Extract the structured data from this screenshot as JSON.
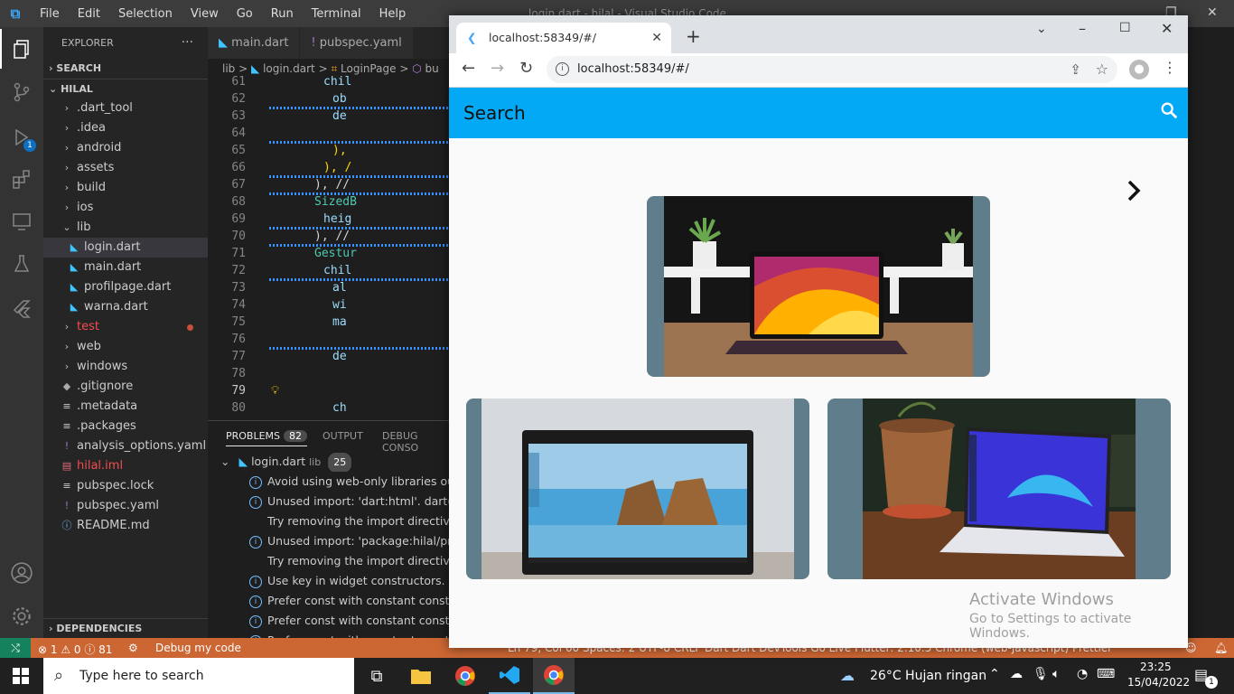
{
  "vscode": {
    "title": "login.dart - hilal - Visual Studio Code",
    "menu": [
      "File",
      "Edit",
      "Selection",
      "View",
      "Go",
      "Run",
      "Terminal",
      "Help"
    ],
    "explorer_label": "EXPLORER",
    "search_section": "SEARCH",
    "project": "HILAL",
    "dependencies": "DEPENDENCIES",
    "run_badge": "1",
    "tree": [
      {
        "label": ".dart_tool",
        "type": "folder"
      },
      {
        "label": ".idea",
        "type": "folder"
      },
      {
        "label": "android",
        "type": "folder"
      },
      {
        "label": "assets",
        "type": "folder"
      },
      {
        "label": "build",
        "type": "folder"
      },
      {
        "label": "ios",
        "type": "folder"
      },
      {
        "label": "lib",
        "type": "folder-open"
      },
      {
        "label": "login.dart",
        "type": "dart",
        "selected": true
      },
      {
        "label": "main.dart",
        "type": "dart"
      },
      {
        "label": "profilpage.dart",
        "type": "dart"
      },
      {
        "label": "warna.dart",
        "type": "dart"
      },
      {
        "label": "test",
        "type": "folder-error"
      },
      {
        "label": "web",
        "type": "folder"
      },
      {
        "label": "windows",
        "type": "folder"
      },
      {
        "label": ".gitignore",
        "type": "git"
      },
      {
        "label": ".metadata",
        "type": "file"
      },
      {
        "label": ".packages",
        "type": "file"
      },
      {
        "label": "analysis_options.yaml",
        "type": "yaml"
      },
      {
        "label": "hilal.iml",
        "type": "iml"
      },
      {
        "label": "pubspec.lock",
        "type": "file"
      },
      {
        "label": "pubspec.yaml",
        "type": "yaml"
      },
      {
        "label": "README.md",
        "type": "info"
      }
    ],
    "tabs": [
      "main.dart",
      "pubspec.yaml"
    ],
    "breadcrumb": [
      "lib",
      ">",
      "login.dart",
      ">",
      "LoginPage",
      ">",
      "bu"
    ],
    "lines": [
      {
        "n": "61",
        "code": "chil",
        "indent": 14
      },
      {
        "n": "62",
        "code": "ob",
        "indent": 15
      },
      {
        "n": "63",
        "code": "de",
        "indent": 15
      },
      {
        "n": "64",
        "code": "",
        "indent": 0
      },
      {
        "n": "65",
        "code": "),",
        "indent": 15
      },
      {
        "n": "66",
        "code": "), /",
        "indent": 14
      },
      {
        "n": "67",
        "code": "), //",
        "indent": 13
      },
      {
        "n": "68",
        "code": "SizedB",
        "indent": 13
      },
      {
        "n": "69",
        "code": "heig",
        "indent": 14
      },
      {
        "n": "70",
        "code": "), //",
        "indent": 13
      },
      {
        "n": "71",
        "code": "Gestur",
        "indent": 13
      },
      {
        "n": "72",
        "code": "chil",
        "indent": 14
      },
      {
        "n": "73",
        "code": "al",
        "indent": 15
      },
      {
        "n": "74",
        "code": "wi",
        "indent": 15
      },
      {
        "n": "75",
        "code": "ma",
        "indent": 15
      },
      {
        "n": "76",
        "code": "",
        "indent": 0
      },
      {
        "n": "77",
        "code": "de",
        "indent": 15
      },
      {
        "n": "78",
        "code": "",
        "indent": 0
      },
      {
        "n": "79",
        "code": "",
        "indent": 0
      },
      {
        "n": "80",
        "code": "ch",
        "indent": 15
      }
    ],
    "panel": {
      "tabs": [
        "PROBLEMS",
        "OUTPUT",
        "DEBUG CONSO"
      ],
      "problems_count": "82",
      "file": "login.dart",
      "file_dir": "lib",
      "file_count": "25",
      "rows": [
        {
          "text": "Avoid using web-only libraries outs",
          "icon": true
        },
        {
          "text": "Unused import: 'dart:html'. dart(un",
          "icon": true
        },
        {
          "text": "Try removing the import directive.",
          "icon": false
        },
        {
          "text": "Unused import: 'package:hilal/profi",
          "icon": true
        },
        {
          "text": "Try removing the import directive.",
          "icon": false
        },
        {
          "text": "Use key in widget constructors. dar",
          "icon": true
        },
        {
          "text": "Prefer const with constant construc",
          "icon": true
        },
        {
          "text": "Prefer const with constant construc",
          "icon": true
        },
        {
          "text": "Prefer const with constant construc",
          "icon": true
        }
      ]
    },
    "status": {
      "problems": "⊗ 1 ⚠ 0 ⓘ 81",
      "debug": "Debug my code",
      "right": "Ln 79, Col 60    Spaces: 2    UTF-8    CRLF    Dart    Dart DevTools    Go Live    Flutter: 2.10.5    Chrome (web-javascript)    Prettier"
    }
  },
  "browser": {
    "tab_title": "localhost:58349/#/",
    "url": "localhost:58349/#/",
    "app": {
      "title": "Search",
      "accent": "#03a9f4",
      "card_color": "#607d8b"
    }
  },
  "windows": {
    "activate_title": "Activate Windows",
    "activate_sub": "Go to Settings to activate Windows.",
    "search_placeholder": "Type here to search",
    "weather": "26°C  Hujan ringan",
    "time": "23:25",
    "date": "15/04/2022",
    "notification_count": "1"
  }
}
